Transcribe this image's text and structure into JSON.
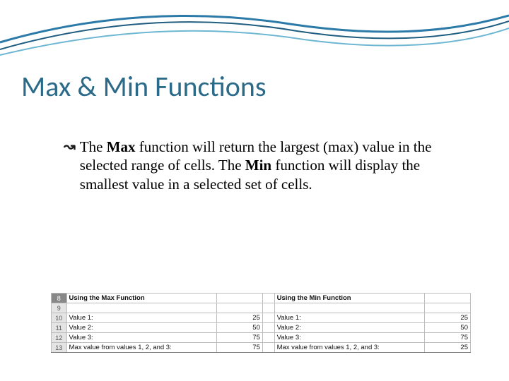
{
  "title": "Max & Min Functions",
  "bullet": {
    "pre": "The ",
    "bold1": "Max",
    "mid1": " function will return the largest (max) value in the selected range of cells. The ",
    "bold2": "Min",
    "mid2": " function will display the smallest value in a selected set of cells."
  },
  "table": {
    "row_headers": [
      "8",
      "9",
      "10",
      "11",
      "12",
      "13"
    ],
    "left_title": "Using the Max Function",
    "right_title": "Using the Min Function",
    "rows": [
      {
        "l_label": "Value 1:",
        "l_val": "25",
        "r_label": "Value 1:",
        "r_val": "25"
      },
      {
        "l_label": "Value 2:",
        "l_val": "50",
        "r_label": "Value 2:",
        "r_val": "50"
      },
      {
        "l_label": "Value 3:",
        "l_val": "75",
        "r_label": "Value 3:",
        "r_val": "75"
      },
      {
        "l_label": "Max value from values 1, 2, and 3:",
        "l_val": "75",
        "r_label": "Max value from values 1, 2, and 3:",
        "r_val": "25"
      }
    ]
  }
}
